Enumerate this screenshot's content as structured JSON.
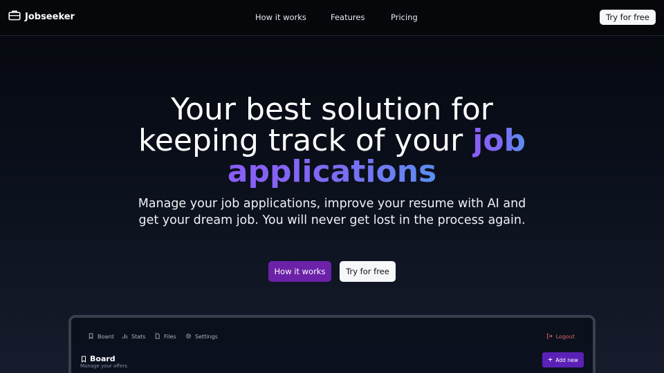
{
  "header": {
    "brand": "Jobseeker",
    "nav": [
      "How it works",
      "Features",
      "Pricing"
    ],
    "cta": "Try for free"
  },
  "hero": {
    "title_line1": "Your best solution for",
    "title_line2_prefix": "keeping track of your",
    "title_highlight_word": "job",
    "title_line3": "applications",
    "subtitle": "Manage your job applications, improve your resume with AI and get your dream job. You will never get lost in the process again.",
    "primary_button": "How it works",
    "secondary_button": "Try for free"
  },
  "preview": {
    "nav": [
      "Board",
      "Stats",
      "Files",
      "Settings"
    ],
    "logout": "Logout",
    "board_title": "Board",
    "board_subtitle": "Manage your offers",
    "add_button": "Add new"
  },
  "colors": {
    "accent": "#6b21a8",
    "gradient_start": "#8b5cf6",
    "gradient_end": "#5a8ff0",
    "logout": "#e06464"
  },
  "icons": {
    "brand": "briefcase-icon",
    "preview_nav": [
      "bookmark-icon",
      "bar-chart-icon",
      "file-icon",
      "gear-icon"
    ],
    "logout": "logout-icon",
    "add": "plus-icon"
  }
}
